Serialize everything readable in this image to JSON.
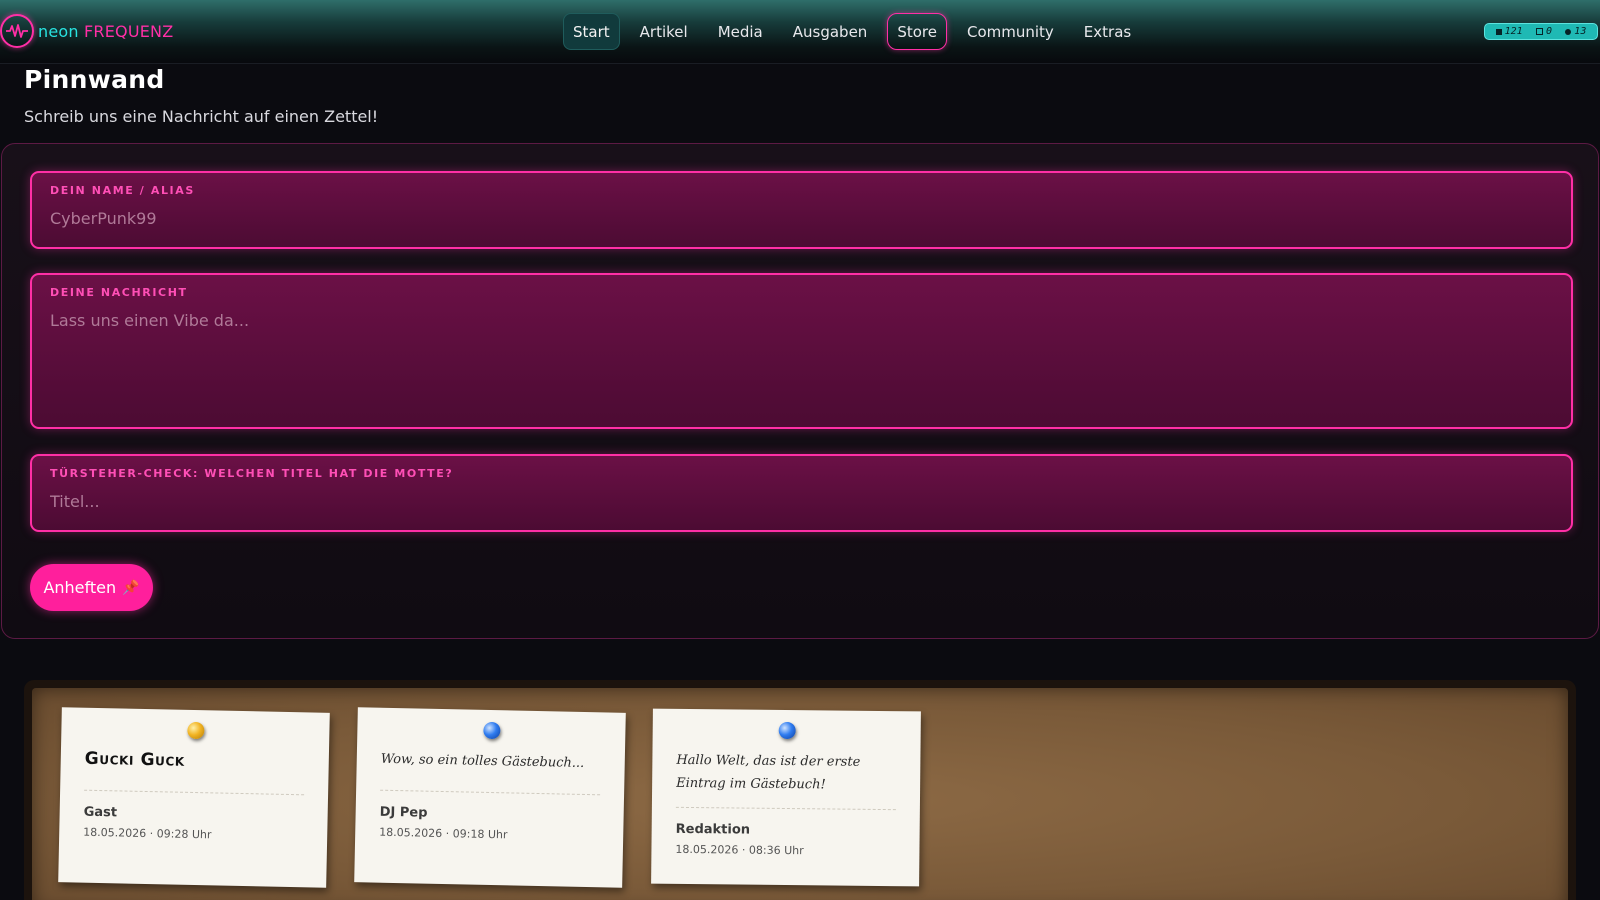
{
  "brand": {
    "name_part1": "neon",
    "name_part2": "FREQUENZ"
  },
  "nav": {
    "items": [
      {
        "label": "Start",
        "active": true
      },
      {
        "label": "Artikel"
      },
      {
        "label": "Media"
      },
      {
        "label": "Ausgaben"
      },
      {
        "label": "Store",
        "highlight": true
      },
      {
        "label": "Community"
      },
      {
        "label": "Extras"
      }
    ]
  },
  "stats": {
    "a": "121",
    "b": "0",
    "c": "13"
  },
  "page": {
    "title": "Pinnwand",
    "subtitle": "Schreib uns eine Nachricht auf einen Zettel!"
  },
  "form": {
    "name_label": "DEIN NAME / ALIAS",
    "name_placeholder": "CyberPunk99",
    "message_label": "DEINE NACHRICHT",
    "message_placeholder": "Lass uns einen Vibe da...",
    "check_label": "TÜRSTEHER-CHECK: WELCHEN TITEL HAT DIE MOTTE?",
    "check_placeholder": "Titel...",
    "submit_label": "Anheften",
    "submit_icon": "📌"
  },
  "notes": [
    {
      "text": "Gucki Guck",
      "author": "Gast",
      "date": "18.05.2026 · 09:28 Uhr",
      "pin": "yellow"
    },
    {
      "text": "Wow, so ein tolles Gästebuch...",
      "author": "DJ Pep",
      "date": "18.05.2026 · 09:18 Uhr",
      "pin": "blue"
    },
    {
      "text": "Hallo Welt, das ist der erste Eintrag im Gästebuch!",
      "author": "Redaktion",
      "date": "18.05.2026 · 08:36 Uhr",
      "pin": "blue"
    }
  ],
  "colors": {
    "accent": "#ff2fa6",
    "brand_cyan": "#28e3e0",
    "board": "#7a5a39"
  }
}
